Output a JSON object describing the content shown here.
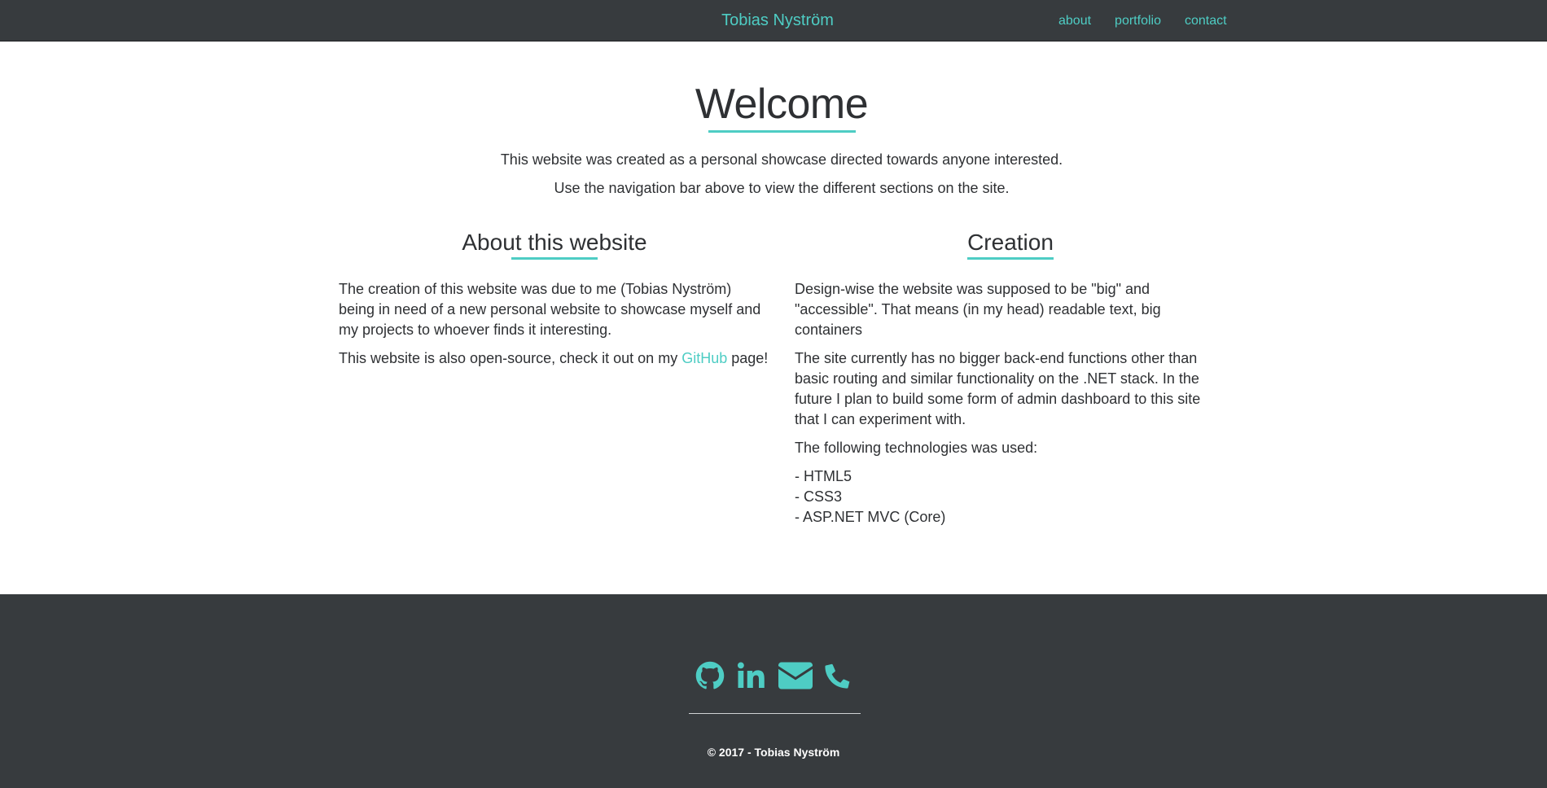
{
  "nav": {
    "brand": "Tobias Nyström",
    "links": [
      "about",
      "portfolio",
      "contact"
    ]
  },
  "welcome": {
    "title": "Welcome",
    "line1": "This website was created as a personal showcase directed towards anyone interested.",
    "line2": "Use the navigation bar above to view the different sections on the site."
  },
  "about": {
    "heading": "About this website",
    "p1": "The creation of this website was due to me (Tobias Nyström) being in need of a new personal website to showcase myself and my projects to whoever finds it interesting.",
    "p2_before": "This website is also open-source, check it out on my ",
    "p2_link": "GitHub",
    "p2_after": " page!"
  },
  "creation": {
    "heading": "Creation",
    "p1": "Design-wise the website was supposed to be \"big\" and \"accessible\". That means (in my head) readable text, big containers",
    "p2": "The site currently has no bigger back-end functions other than basic routing and similar functionality on the .NET stack. In the future I plan to build some form of admin dashboard to this site that I can experiment with.",
    "p3": "The following technologies was used:",
    "technologies": [
      "- HTML5",
      "- CSS3",
      "- ASP.NET MVC (Core)"
    ]
  },
  "footer": {
    "icons": [
      "github-icon",
      "linkedin-icon",
      "envelope-icon",
      "phone-icon"
    ],
    "copyright": "© 2017 - Tobias Nyström"
  },
  "colors": {
    "accent": "#4ecdc4",
    "dark": "#373b3e",
    "text": "#2e3033"
  }
}
